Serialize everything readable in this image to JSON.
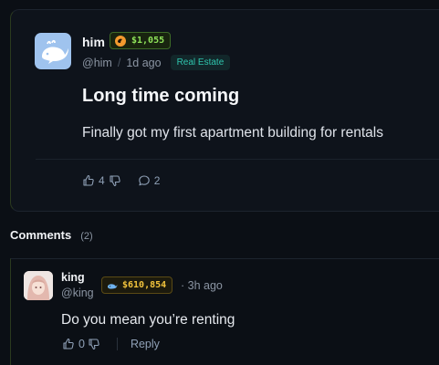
{
  "post": {
    "author": "him",
    "balance": "$1,055",
    "handle": "@him",
    "separator": "/",
    "time": "1d ago",
    "category": "Real Estate",
    "title": "Long time coming",
    "body": "Finally got my first apartment building for rentals",
    "likes": "4",
    "comments": "2"
  },
  "comments_section": {
    "heading": "Comments",
    "count": "(2)"
  },
  "comment": {
    "author": "king",
    "handle": "@king",
    "balance": "$610,854",
    "time": "· 3h ago",
    "text": "Do you mean you’re renting",
    "likes": "0",
    "reply_label": "Reply"
  },
  "colors": {
    "accent_green": "#8fe35a",
    "accent_gold": "#f2c33c",
    "tag_teal": "#2fc6ae"
  }
}
